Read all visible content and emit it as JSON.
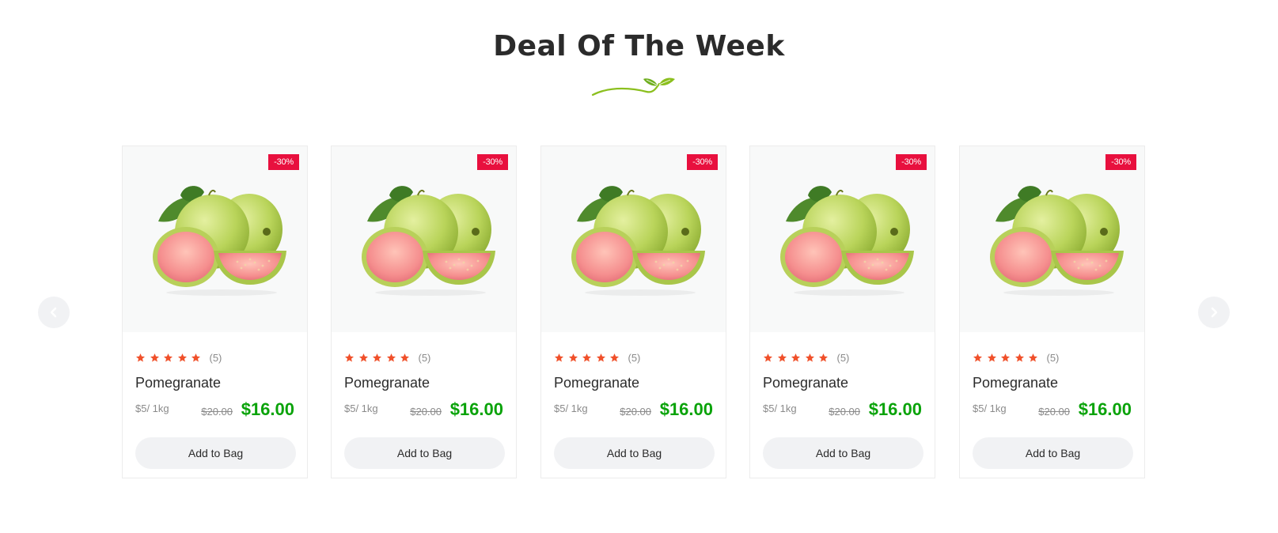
{
  "section": {
    "title": "Deal Of The Week"
  },
  "carousel": {
    "prev_icon": "chevron-left-icon",
    "next_icon": "chevron-right-icon"
  },
  "colors": {
    "badge": "#e8103e",
    "star": "#f0502a",
    "price": "#0aa30a",
    "button_bg": "#f1f2f4",
    "leaf_accent": "#8bbf1e"
  },
  "products": [
    {
      "badge": "-30%",
      "rating": 5,
      "rating_count": "(5)",
      "name": "Pomegranate",
      "unit_price": "$5/ 1kg",
      "old_price": "$20.00",
      "price": "$16.00",
      "button_label": "Add to Bag"
    },
    {
      "badge": "-30%",
      "rating": 5,
      "rating_count": "(5)",
      "name": "Pomegranate",
      "unit_price": "$5/ 1kg",
      "old_price": "$20.00",
      "price": "$16.00",
      "button_label": "Add to Bag"
    },
    {
      "badge": "-30%",
      "rating": 5,
      "rating_count": "(5)",
      "name": "Pomegranate",
      "unit_price": "$5/ 1kg",
      "old_price": "$20.00",
      "price": "$16.00",
      "button_label": "Add to Bag"
    },
    {
      "badge": "-30%",
      "rating": 5,
      "rating_count": "(5)",
      "name": "Pomegranate",
      "unit_price": "$5/ 1kg",
      "old_price": "$20.00",
      "price": "$16.00",
      "button_label": "Add to Bag"
    },
    {
      "badge": "-30%",
      "rating": 5,
      "rating_count": "(5)",
      "name": "Pomegranate",
      "unit_price": "$5/ 1kg",
      "old_price": "$20.00",
      "price": "$16.00",
      "button_label": "Add to Bag"
    }
  ]
}
